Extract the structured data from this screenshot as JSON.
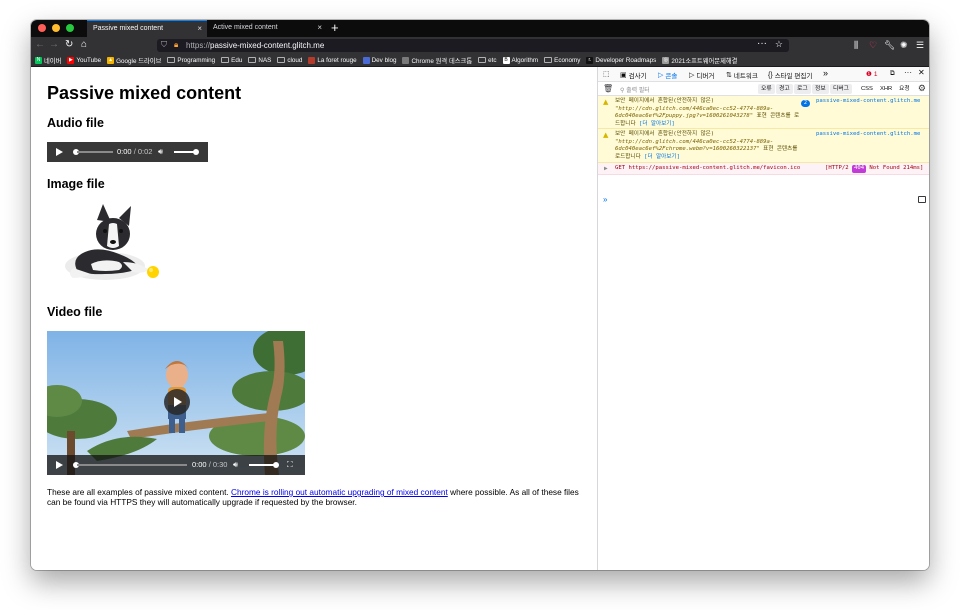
{
  "tabs": [
    {
      "title": "Passive mixed content",
      "close": "×"
    },
    {
      "title": "Active mixed content",
      "close": "×"
    }
  ],
  "new_tab": "+",
  "address": {
    "scheme": "https://",
    "host": "passive-mixed-content.glitch.me"
  },
  "bookmarks": [
    {
      "label": "네이버",
      "color": "#03c75a",
      "glyph": "N"
    },
    {
      "label": "YouTube",
      "color": "#ff0000",
      "glyph": "▶"
    },
    {
      "label": "Google 드라이브",
      "color": "#f4b400",
      "glyph": "▲"
    },
    {
      "label": "Programming",
      "folder": true
    },
    {
      "label": "Edu",
      "folder": true
    },
    {
      "label": "NAS",
      "folder": true
    },
    {
      "label": "cloud",
      "folder": true
    },
    {
      "label": "La foret rouge",
      "color": "#b23b2b",
      "glyph": ""
    },
    {
      "label": "Dev blog",
      "color": "#4a6bd6",
      "glyph": ""
    },
    {
      "label": "Chrome 원격 데스크톱",
      "color": "#7a7a7a",
      "glyph": ""
    },
    {
      "label": "etc",
      "folder": true
    },
    {
      "label": "Algorithm",
      "color": "#ffffff",
      "glyph": "B"
    },
    {
      "label": "Economy",
      "folder": true
    },
    {
      "label": "Developer Roadmaps",
      "color": "#111111",
      "glyph": "r."
    },
    {
      "label": "2021소프트웨어문제해결",
      "color": "#9a9a9a",
      "glyph": "◎"
    }
  ],
  "page": {
    "title": "Passive mixed content",
    "audio_heading": "Audio file",
    "audio_time": "0:00",
    "audio_duration": " / 0:02",
    "image_heading": "Image file",
    "video_heading": "Video file",
    "video_time": "0:00",
    "video_duration": " / 0:30",
    "para_before": "These are all examples of passive mixed content. ",
    "para_link": "Chrome is rolling out automatic upgrading of mixed content",
    "para_after": " where possible. As all of these files can be found via HTTPS they will automatically upgrade if requested by the browser."
  },
  "devtools": {
    "tabs": [
      "검사기",
      "콘솔",
      "디버거",
      "네트워크",
      "스타일 편집기"
    ],
    "error_count": "1",
    "filter_placeholder": "출력 필터",
    "levels": [
      "오류",
      "경고",
      "로그",
      "정보",
      "디버그"
    ],
    "types": [
      "CSS",
      "XHR",
      "요청"
    ],
    "messages": [
      {
        "prefix": "보안 페이지에서 혼합된(안전하지 않은) ",
        "url": "\"http://cdn.glitch.com/446ca0ec-cc52-4774-889a-6dc040eac6ef%2Fpuppy.jpg?v=1600261043278\"",
        "suffix": " 표현 콘텐츠를 로드합니다 ",
        "learn": "[더 알아보기]",
        "count": "2",
        "source": "passive-mixed-content.glitch.me"
      },
      {
        "prefix": "보안 페이지에서 혼합된(안전하지 않은) ",
        "url": "\"http://cdn.glitch.com/446ca0ec-cc52-4774-889a-6dc040eac6ef%2Fchrome.webm?v=1600260322137\"",
        "suffix": " 표현 콘텐츠를 로드합니다 ",
        "learn": "[더 알아보기]",
        "source": "passive-mixed-content.glitch.me"
      }
    ],
    "error": {
      "request": "GET https://passive-mixed-content.glitch.me/favicon.ico",
      "protocol": "[HTTP/2 ",
      "code": "404",
      "status": " Not Found 214ms]"
    },
    "prompt": "»"
  }
}
